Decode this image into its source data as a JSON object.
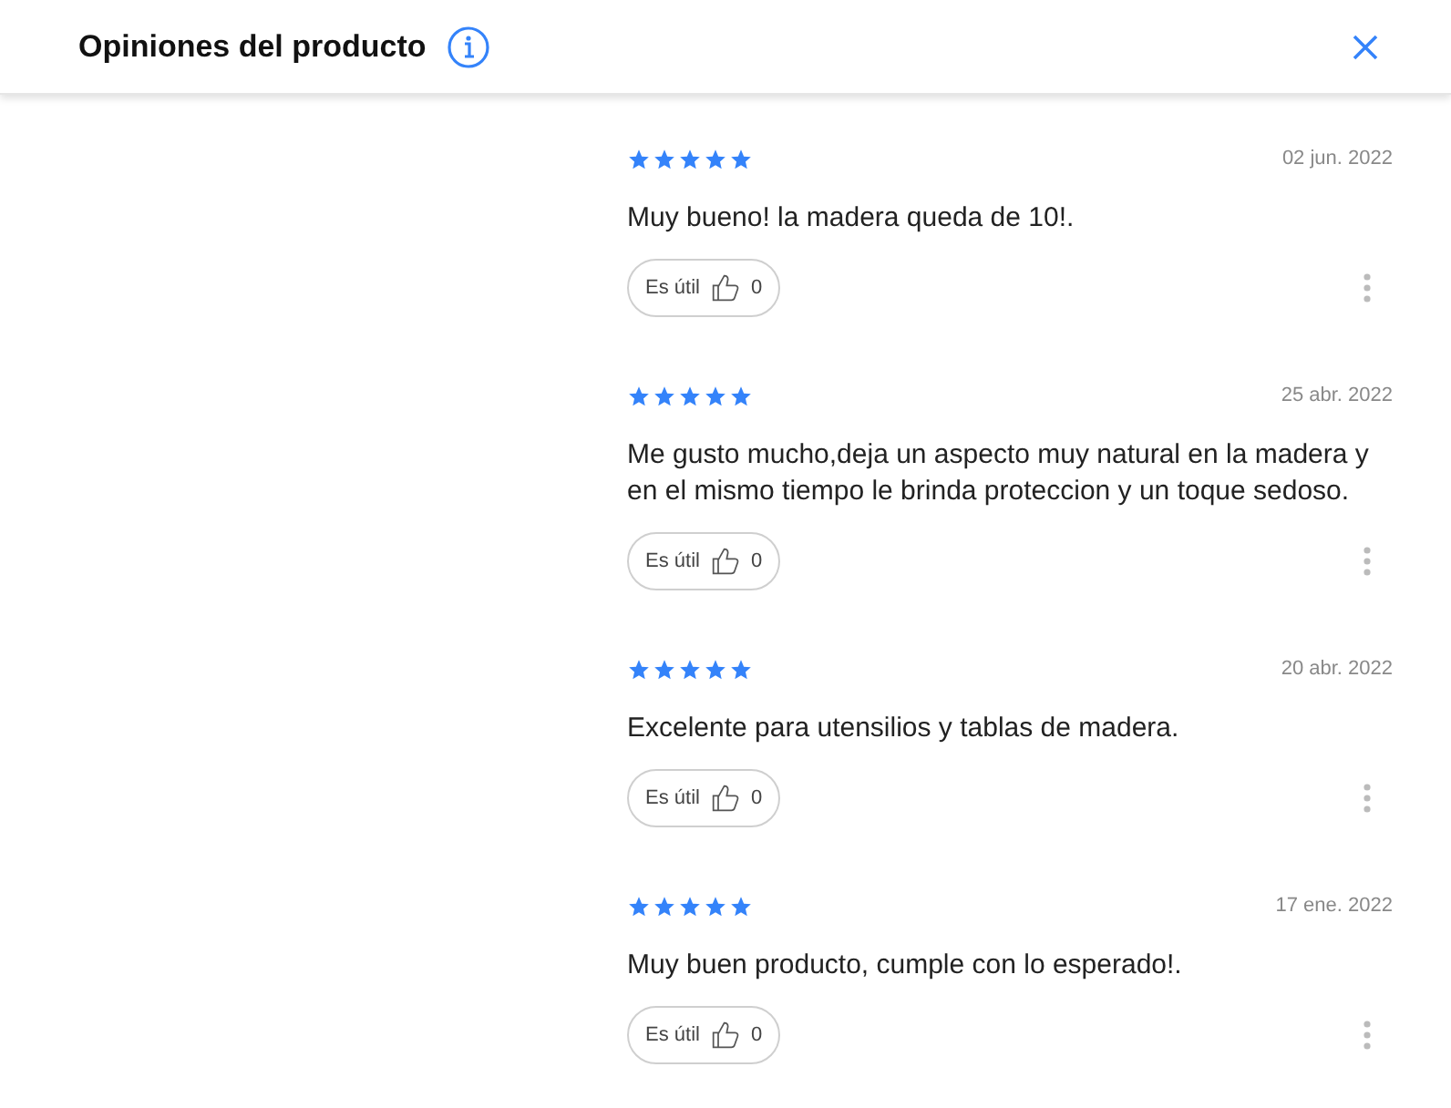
{
  "header": {
    "title": "Opiniones del producto"
  },
  "reviews": [
    {
      "stars": 5,
      "date": "02 jun. 2022",
      "text": "Muy bueno! la madera queda de 10!.",
      "helpful_label": "Es útil",
      "helpful_count": "0"
    },
    {
      "stars": 5,
      "date": "25 abr. 2022",
      "text": "Me gusto mucho,deja un aspecto muy natural en la madera y en el mismo tiempo le brinda proteccion y un toque sedoso.",
      "helpful_label": "Es útil",
      "helpful_count": "0"
    },
    {
      "stars": 5,
      "date": "20 abr. 2022",
      "text": "Excelente para utensilios y tablas de madera.",
      "helpful_label": "Es útil",
      "helpful_count": "0"
    },
    {
      "stars": 5,
      "date": "17 ene. 2022",
      "text": "Muy buen producto, cumple con lo esperado!.",
      "helpful_label": "Es útil",
      "helpful_count": "0"
    }
  ]
}
